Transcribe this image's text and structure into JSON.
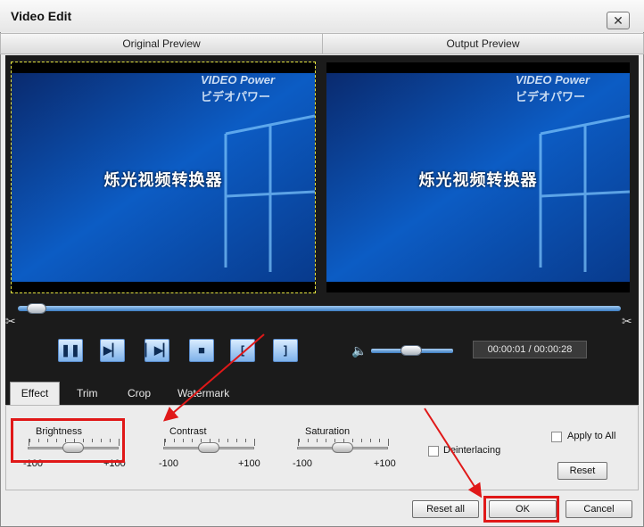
{
  "window": {
    "title": "Video Edit",
    "close_symbol": "✕"
  },
  "preview": {
    "original_header": "Original Preview",
    "output_header": "Output Preview",
    "screen_text": "烁光视频转换器",
    "brand_line1": "VIDEO Power",
    "brand_line2": "ビデオパワー"
  },
  "player": {
    "timecode": "00:00:01 / 00:00:28",
    "buttons": [
      {
        "name": "pause-button",
        "glyph": "❚❚",
        "icon": "pause-icon"
      },
      {
        "name": "next-frame-button",
        "glyph": "▶▏",
        "icon": "step-forward-icon"
      },
      {
        "name": "play-frame-button",
        "glyph": "▏▶▏",
        "icon": "frame-icon"
      },
      {
        "name": "stop-button",
        "glyph": "■",
        "icon": "stop-icon"
      },
      {
        "name": "set-start-button",
        "glyph": "[",
        "icon": "bracket-left-icon"
      },
      {
        "name": "set-end-button",
        "glyph": "]",
        "icon": "bracket-right-icon"
      }
    ],
    "timeline_position": 0.02,
    "volume_level": 0.5
  },
  "tabs": [
    "Effect",
    "Trim",
    "Crop",
    "Watermark"
  ],
  "effect": {
    "sliders": [
      {
        "label": "Brightness",
        "min": "-100",
        "max": "+100",
        "value": 0
      },
      {
        "label": "Contrast",
        "min": "-100",
        "max": "+100",
        "value": 0
      },
      {
        "label": "Saturation",
        "min": "-100",
        "max": "+100",
        "value": 0
      }
    ],
    "deinterlacing_label": "Deinterlacing",
    "apply_all_label": "Apply to All",
    "reset_label": "Reset"
  },
  "footer": {
    "reset_all_label": "Reset all",
    "ok_label": "OK",
    "cancel_label": "Cancel"
  },
  "colors": {
    "annotation_red": "#e01818",
    "accent_blue": "#3d7fc4"
  }
}
